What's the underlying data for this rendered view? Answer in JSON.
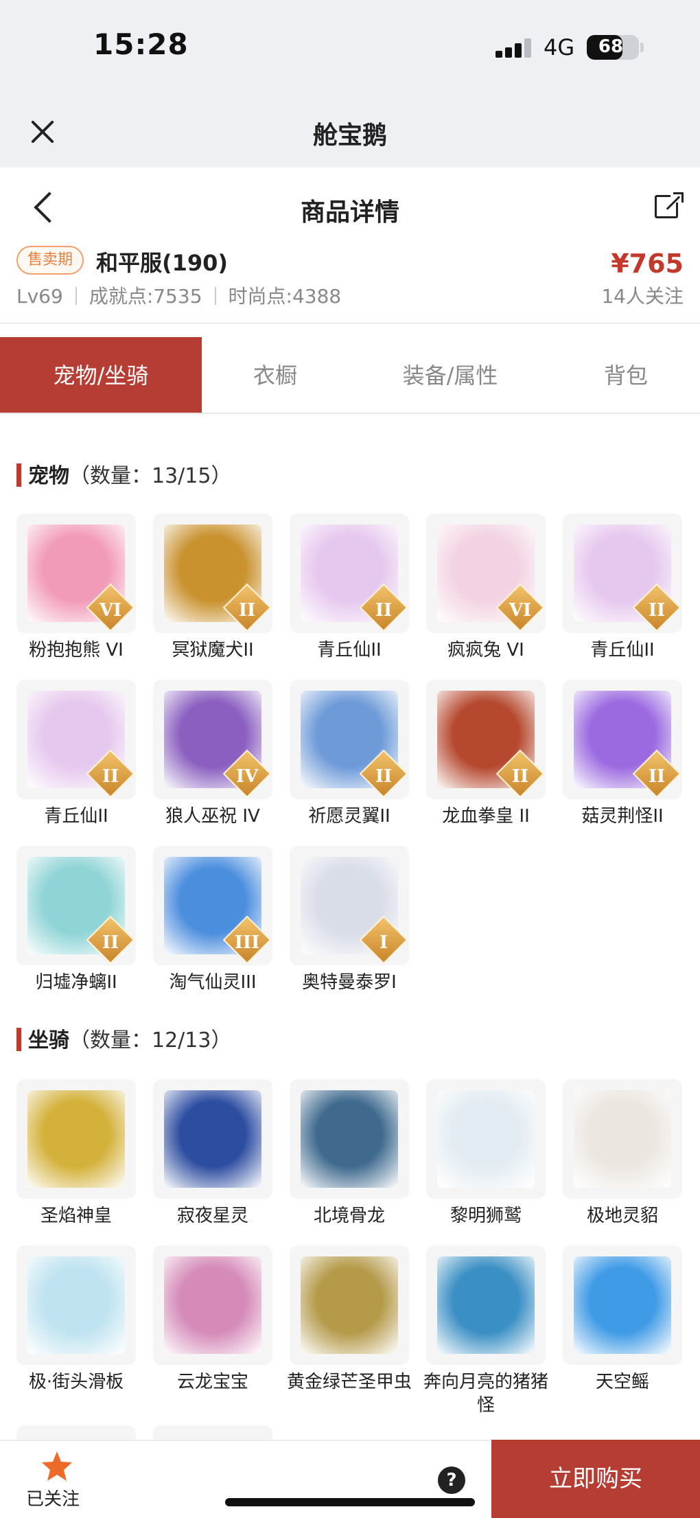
{
  "status_bar": {
    "time": "15:28",
    "network": "4G",
    "battery": "68"
  },
  "app_bar": {
    "title": "舱宝鹅"
  },
  "page_header": {
    "title": "商品详情"
  },
  "product": {
    "status_badge": "售卖期",
    "server": "和平服(190)",
    "price": "¥765",
    "level": "Lv69",
    "achievement": "成就点:7535",
    "fashion": "时尚点:4388",
    "followers": "14人关注"
  },
  "tabs": [
    {
      "label": "宠物/坐骑",
      "active": true
    },
    {
      "label": "衣橱",
      "active": false
    },
    {
      "label": "装备/属性",
      "active": false
    },
    {
      "label": "背包",
      "active": false
    }
  ],
  "pets_section": {
    "name": "宠物",
    "count": "（数量：13/15）"
  },
  "pets": [
    {
      "name": "粉抱抱熊 VI",
      "tier": "VI",
      "color": "#f29bb8"
    },
    {
      "name": "冥狱魔犬II",
      "tier": "II",
      "color": "#c9922f"
    },
    {
      "name": "青丘仙II",
      "tier": "II",
      "color": "#e6c8ee"
    },
    {
      "name": "疯疯兔 VI",
      "tier": "VI",
      "color": "#f3d3e3"
    },
    {
      "name": "青丘仙II",
      "tier": "II",
      "color": "#e6c8ee"
    },
    {
      "name": "青丘仙II",
      "tier": "II",
      "color": "#e6c8ee"
    },
    {
      "name": "狼人巫祝 IV",
      "tier": "IV",
      "color": "#8a5fc0"
    },
    {
      "name": "祈愿灵翼II",
      "tier": "II",
      "color": "#6e9bd8"
    },
    {
      "name": "龙血拳皇 II",
      "tier": "II",
      "color": "#b5482e"
    },
    {
      "name": "菇灵荆怪II",
      "tier": "II",
      "color": "#9b6ae0"
    },
    {
      "name": "归墟净螭II",
      "tier": "II",
      "color": "#8fd4d6"
    },
    {
      "name": "淘气仙灵III",
      "tier": "III",
      "color": "#4b8ede"
    },
    {
      "name": "奥特曼泰罗I",
      "tier": "I",
      "color": "#d9dde8"
    }
  ],
  "mounts_section": {
    "name": "坐骑",
    "count": "（数量：12/13）"
  },
  "mounts": [
    {
      "name": "圣焰神皇",
      "color": "#d4b13a"
    },
    {
      "name": "寂夜星灵",
      "color": "#2d4da0"
    },
    {
      "name": "北境骨龙",
      "color": "#3f6a8e"
    },
    {
      "name": "黎明狮鹫",
      "color": "#e3ecf2"
    },
    {
      "name": "极地灵貂",
      "color": "#ece6e0"
    },
    {
      "name": "极·街头滑板",
      "color": "#bfe3f0"
    },
    {
      "name": "云龙宝宝",
      "color": "#d58ab8"
    },
    {
      "name": "黄金绿芒圣甲虫",
      "color": "#b59a4a"
    },
    {
      "name": "奔向月亮的猪猪怪",
      "color": "#3a8fc4"
    },
    {
      "name": "天空鳐",
      "color": "#3f9be6"
    }
  ],
  "bottom_bar": {
    "follow_label": "已关注",
    "help": "?",
    "buy_label": "立即购买"
  },
  "colors": {
    "accent": "#b63d33",
    "price": "#c0392b",
    "badge": "#e47f3e",
    "star": "#ee6a2b"
  }
}
